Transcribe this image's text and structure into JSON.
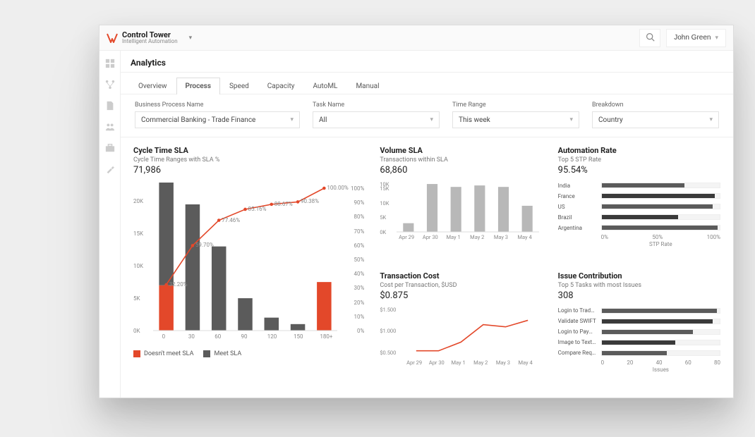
{
  "header": {
    "app_title": "Control Tower",
    "app_subtitle": "Intelligent Automation",
    "user_name": "John Green"
  },
  "page": {
    "title": "Analytics",
    "tabs": [
      {
        "label": "Overview"
      },
      {
        "label": "Process",
        "active": true
      },
      {
        "label": "Speed"
      },
      {
        "label": "Capacity"
      },
      {
        "label": "AutoML"
      },
      {
        "label": "Manual"
      }
    ]
  },
  "filters": {
    "business_process": {
      "label": "Business Process Name",
      "value": "Commercial Banking - Trade Finance"
    },
    "task_name": {
      "label": "Task Name",
      "value": "All"
    },
    "time_range": {
      "label": "Time Range",
      "value": "This week"
    },
    "breakdown": {
      "label": "Breakdown",
      "value": "Country"
    }
  },
  "cards": {
    "cycle_time": {
      "title": "Cycle Time SLA",
      "subtitle": "Cycle Time Ranges with SLA %",
      "value": "71,986",
      "legend_fail": "Doesn't meet SLA",
      "legend_pass": "Meet SLA"
    },
    "volume": {
      "title": "Volume SLA",
      "subtitle": "Transactions within SLA",
      "value": "68,860"
    },
    "automation": {
      "title": "Automation Rate",
      "subtitle": "Top 5 STP Rate",
      "value": "95.54%",
      "axis_label": "STP Rate",
      "axis_ticks": [
        "0%",
        "50%",
        "100%"
      ]
    },
    "cost": {
      "title": "Transaction Cost",
      "subtitle": "Cost per Transaction, $USD",
      "value": "$0.875"
    },
    "issues": {
      "title": "Issue Contribution",
      "subtitle": "Top 5 Tasks with most Issues",
      "value": "308",
      "axis_label": "Issues",
      "axis_ticks": [
        "0",
        "20",
        "40",
        "60",
        "80"
      ]
    }
  },
  "chart_data": [
    {
      "id": "cycle_time",
      "type": "bar+line",
      "categories": [
        "0",
        "30",
        "60",
        "90",
        "120",
        "150",
        "180+"
      ],
      "series": [
        {
          "name": "Doesn't meet SLA",
          "color": "#e3482a",
          "values": [
            7000,
            0,
            0,
            0,
            0,
            0,
            7500
          ]
        },
        {
          "name": "Meet SLA",
          "color": "#5b5b5b",
          "values": [
            22000,
            19500,
            13000,
            5000,
            2000,
            1000,
            0
          ]
        }
      ],
      "line": {
        "name": "SLA % cumulative",
        "values": [
          32.2,
          59.7,
          77.46,
          85.16,
          88.67,
          90.38,
          100.0
        ],
        "labels": [
          "32.20%",
          "59.70%",
          "77.46%",
          "85.16%",
          "88.67%",
          "90.38%",
          "100.00%"
        ],
        "color": "#e3482a"
      },
      "y1": {
        "ticks": [
          "0K",
          "5K",
          "10K",
          "15K",
          "20K"
        ],
        "range": [
          0,
          22000
        ]
      },
      "y2": {
        "ticks": [
          "0%",
          "10%",
          "20%",
          "30%",
          "40%",
          "50%",
          "60%",
          "70%",
          "80%",
          "90%",
          "100%"
        ],
        "range": [
          0,
          100
        ]
      }
    },
    {
      "id": "volume",
      "type": "bar",
      "categories": [
        "Apr 29",
        "Apr 30",
        "May 1",
        "May 2",
        "May 3",
        "May 4"
      ],
      "series": [
        {
          "name": "within SLA",
          "color": "#b8b8b8",
          "values": [
            3000,
            16500,
            15500,
            16000,
            15500,
            9000
          ]
        }
      ],
      "y": {
        "ticks": [
          "0K",
          "5K",
          "10K",
          "15K",
          "10K"
        ],
        "range": [
          0,
          17000
        ]
      }
    },
    {
      "id": "automation_rate",
      "type": "hbar",
      "categories": [
        "India",
        "France",
        "US",
        "Brazil",
        "Argentina"
      ],
      "values": [
        70,
        96,
        94,
        65,
        98
      ],
      "xrange": [
        0,
        100
      ],
      "xlabel": "STP Rate"
    },
    {
      "id": "transaction_cost",
      "type": "line",
      "categories": [
        "Apr 29",
        "Apr 30",
        "May 1",
        "May 2",
        "May 3",
        "May 4"
      ],
      "values": [
        0.55,
        0.55,
        0.75,
        1.15,
        1.1,
        1.25
      ],
      "y": {
        "ticks": [
          "$0.500",
          "$1.000",
          "$1.500"
        ],
        "range": [
          0.4,
          1.5
        ]
      },
      "color": "#e3482a"
    },
    {
      "id": "issue_contribution",
      "type": "hbar",
      "categories": [
        "Login to Trade Fi..",
        "Validate SWIFT",
        "Login to Payment..",
        "Image to Text via..",
        "Compare Reques.."
      ],
      "values": [
        78,
        75,
        62,
        50,
        44
      ],
      "xrange": [
        0,
        80
      ],
      "xlabel": "Issues"
    }
  ]
}
